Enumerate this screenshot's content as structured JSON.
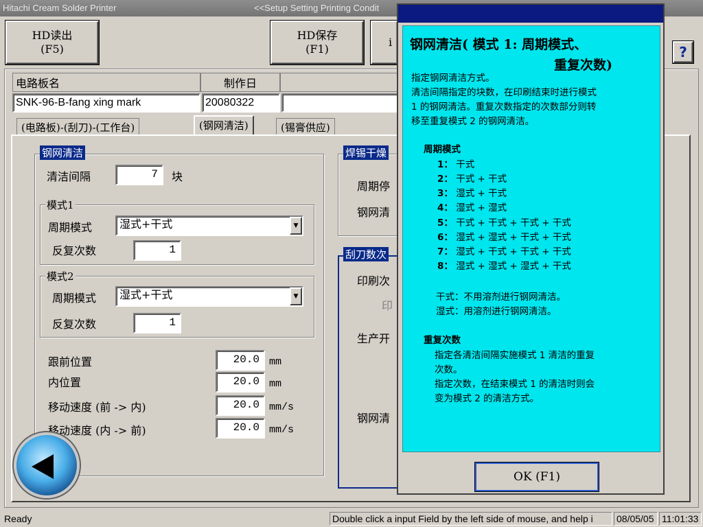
{
  "window": {
    "title": "Hitachi Cream Solder Printer",
    "subtitle": "<<Setup Setting Printing Condit"
  },
  "toolbar": {
    "hd_load": {
      "line1": "HD读出",
      "line2": "(F5)"
    },
    "hd_save": {
      "line1": "HD保存",
      "line2": "(F1)"
    },
    "partial": "i",
    "help_icon": "?"
  },
  "board": {
    "name_label": "电路板名",
    "date_label": "制作日",
    "name_value": "SNK-96-B-fang xing mark",
    "date_value": "20080322"
  },
  "tabs": [
    {
      "label": "(电路板)-(刮刀)-(工作台)"
    },
    {
      "label": "(钢网清洁)"
    },
    {
      "label": "(锡膏供应)"
    }
  ],
  "cleaning": {
    "title": "钢网清洁",
    "interval_label": "清洁间隔",
    "interval_value": "7",
    "interval_unit": "块",
    "mode1": {
      "title": "模式1",
      "cycle_label": "周期模式",
      "cycle_value": "湿式+干式",
      "repeat_label": "反复次数",
      "repeat_value": "1"
    },
    "mode2": {
      "title": "模式2",
      "cycle_label": "周期模式",
      "cycle_value": "湿式+干式",
      "repeat_label": "反复次数",
      "repeat_value": "1"
    },
    "front_pos_label": "跟前位置",
    "front_pos_value": "20.0",
    "inner_pos_label": "内位置",
    "inner_pos_value": "20.0",
    "speed_fi_label": "移动速度 (前 -> 内)",
    "speed_fi_value": "20.0",
    "speed_if_label": "移动速度 (内 -> 前)",
    "speed_if_value": "20.0",
    "unit_mm": "mm",
    "unit_mms": "mm/s"
  },
  "right_panel": {
    "solder_title": "焊锡干燥",
    "period_label": "周期停",
    "stencil_label": "钢网清",
    "squeegee_title": "刮刀数次",
    "print_label": "印刷次",
    "print_sub": "印",
    "prod_label": "生产开",
    "stencil2_label": "钢网清"
  },
  "help": {
    "title_line1": "钢网清洁( 模式 1: 周期模式、",
    "title_line2": "重复次数)",
    "intro": [
      "指定钢网清洁方式。",
      "清洁间隔指定的块数，在印刷结束时进行模式",
      "1 的钢网清洁。重复次数指定的次数部分则转",
      "移至重复模式 2 的钢网清洁。"
    ],
    "cycle_heading": "周期模式",
    "cycle_items": [
      {
        "num": "1：",
        "text": "干式"
      },
      {
        "num": "2：",
        "text": "干式 + 干式"
      },
      {
        "num": "3：",
        "text": "湿式 + 干式"
      },
      {
        "num": "4：",
        "text": "湿式 + 湿式"
      },
      {
        "num": "5：",
        "text": "干式 + 干式 + 干式 + 干式"
      },
      {
        "num": "6：",
        "text": "湿式 + 湿式 + 干式 + 干式"
      },
      {
        "num": "7：",
        "text": "湿式 + 干式 + 干式 + 干式"
      },
      {
        "num": "8：",
        "text": "湿式 + 湿式 + 湿式 + 干式"
      }
    ],
    "dry_note": "干式：不用溶剂进行钢网清洁。",
    "wet_note": "湿式：用溶剂进行钢网清洁。",
    "repeat_heading": "重复次数",
    "repeat_lines": [
      "指定各清洁间隔实施模式 1 清洁的重复",
      "次数。",
      "指定次数，在结束模式 1 的清洁时则会",
      "变为模式 2 的清洁方式。"
    ],
    "ok_label": "OK (F1)"
  },
  "status": {
    "ready": "Ready",
    "hint": "Double click a input Field by the left side of mouse, and help i",
    "date": "08/05/05",
    "time": "11:01:33"
  }
}
